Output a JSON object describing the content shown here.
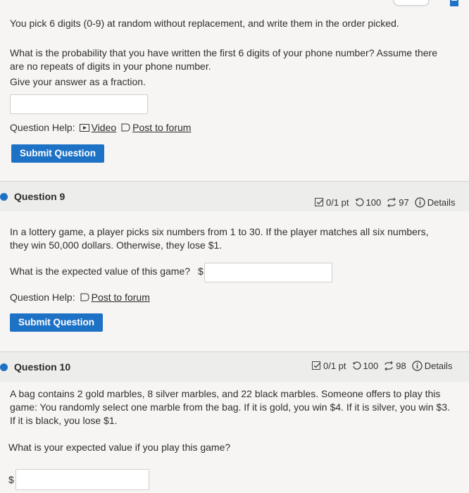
{
  "top_icons": {
    "icon_a": "refresh-icon",
    "icon_b": "calculator-icon"
  },
  "q8": {
    "text1": "You pick 6 digits (0-9) at random without replacement, and write them in the order picked.",
    "text2": "What is the probability that you have written the first 6 digits of your phone number? Assume there are no repeats of digits in your phone number.",
    "text3": "Give your answer as a fraction.",
    "help_label": "Question Help:",
    "video_label": "Video",
    "forum_label": "Post to forum",
    "submit_label": "Submit Question"
  },
  "q9": {
    "title": "Question 9",
    "points": "0/1 pt",
    "retries": "100",
    "attempts": "97",
    "details": "Details",
    "text1": "In a lottery game, a player picks six numbers from 1 to 30. If the player matches all six numbers, they win 50,000 dollars. Otherwise, they lose $1.",
    "prompt": "What is the expected value of this game?",
    "dollar": "$",
    "help_label": "Question Help:",
    "forum_label": "Post to forum",
    "submit_label": "Submit Question"
  },
  "q10": {
    "title": "Question 10",
    "points": "0/1 pt",
    "retries": "100",
    "attempts": "98",
    "details": "Details",
    "text1": "A bag contains 2 gold marbles, 8 silver marbles, and 22 black marbles. Someone offers to play this game: You randomly select one marble from the bag. If it is gold, you win $4. If it is silver, you win $3. If it is black, you lose $1.",
    "prompt": "What is your expected value if you play this game?",
    "dollar": "$"
  },
  "colors": {
    "accent": "#1e72c6",
    "header_bg": "#ededec"
  }
}
